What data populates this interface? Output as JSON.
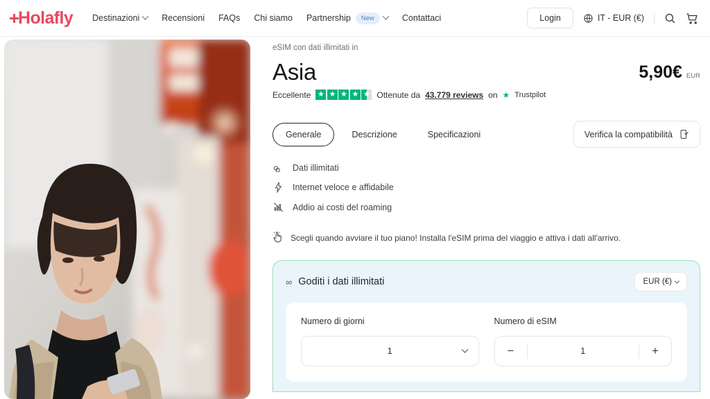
{
  "header": {
    "logo_text": "Holafly",
    "nav": [
      {
        "label": "Destinazioni",
        "caret": true,
        "badge": null
      },
      {
        "label": "Recensioni",
        "caret": false,
        "badge": null
      },
      {
        "label": "FAQs",
        "caret": false,
        "badge": null
      },
      {
        "label": "Chi siamo",
        "caret": false,
        "badge": null
      },
      {
        "label": "Partnership",
        "caret": true,
        "badge": "New"
      },
      {
        "label": "Contattaci",
        "caret": false,
        "badge": null
      }
    ],
    "login_label": "Login",
    "locale_label": "IT - EUR (€)",
    "icons": {
      "globe": "globe-icon",
      "search": "search-icon",
      "cart": "cart-icon"
    }
  },
  "product": {
    "eyebrow": "eSIM con dati illimitati in",
    "title": "Asia",
    "price": "5,90€",
    "price_currency": "EUR",
    "rating": {
      "label": "Eccellente",
      "stars_filled": 4,
      "stars_half": true,
      "stars_total": 5,
      "prefix": "Ottenute da",
      "reviews_count": "43.779 reviews",
      "on_text": "on",
      "platform": "Trustpilot",
      "star_color": "#00b67a"
    }
  },
  "tabs": [
    {
      "label": "Generale",
      "active": true
    },
    {
      "label": "Descrizione",
      "active": false
    },
    {
      "label": "Specificazioni",
      "active": false
    }
  ],
  "compatibility_button": {
    "label": "Verifica la compatibilità",
    "icon": "phone-check-icon"
  },
  "features": [
    {
      "icon": "infinity-icon",
      "label": "Dati illimitati"
    },
    {
      "icon": "lightning-bolt-icon",
      "label": "Internet veloce e affidabile"
    },
    {
      "icon": "no-roaming-icon",
      "label": "Addio ai costi del roaming"
    }
  ],
  "tip": {
    "icon": "tap-hand-icon",
    "text": "Scegli quando avviare il tuo piano! Installa l'eSIM prima del viaggio e attiva i dati all'arrivo."
  },
  "plan_card": {
    "title": "Goditi i dati illimitati",
    "title_icon": "infinity-icon",
    "currency_selector": "EUR (€)",
    "border_color": "#9fdcb6",
    "background_color": "#eaf5fb",
    "days": {
      "label": "Numero di giorni",
      "value": "1"
    },
    "esim": {
      "label": "Numero di eSIM",
      "value": "1",
      "minus_label": "−",
      "plus_label": "+"
    }
  },
  "hero": {
    "alt": "woman-using-phone-on-japanese-street"
  }
}
